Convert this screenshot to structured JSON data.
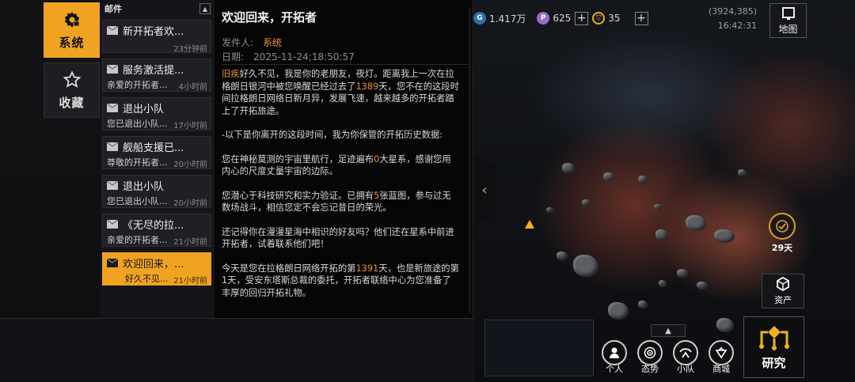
{
  "categories": [
    {
      "label": "系统",
      "icon": "gear-icon",
      "active": true
    },
    {
      "label": "收藏",
      "icon": "star-icon",
      "active": false
    }
  ],
  "mail_list": {
    "header": "邮件",
    "items": [
      {
        "subject": "新开拓者欢...",
        "preview": "",
        "time": "23分钟前"
      },
      {
        "subject": "服务激活提...",
        "preview": "亲爱的开拓者...",
        "time": "4小时前"
      },
      {
        "subject": "退出小队",
        "preview": "您已退出小队...",
        "time": "17小时前"
      },
      {
        "subject": "舰船支援已...",
        "preview": "尊敬的开拓者...",
        "time": "20小时前"
      },
      {
        "subject": "退出小队",
        "preview": "您已退出小队...",
        "time": "20小时前"
      },
      {
        "subject": "《无尽的拉...",
        "preview": "亲爱的开拓者...",
        "time": "21小时前"
      },
      {
        "subject": "欢迎回来，...",
        "preview": "好久不见...",
        "time": "21小时前",
        "active": true
      }
    ]
  },
  "mail_content": {
    "title": "欢迎回来，开拓者",
    "sender_label": "发件人:",
    "sender": "系统",
    "date_label": "日期:",
    "date": "2025-11-24;18:50:57",
    "p1_hl1": "旧疾",
    "p1_a": "好久不见，我是你的老朋友，夜灯。距离我上一次在拉格朗日银河中被您唤醒已经过去了",
    "p1_hl2": "1389",
    "p1_b": "天，您不在的这段时间拉格朗日网络日新月异，发展飞速，越来越多的开拓者踏上了开拓旅途。",
    "p2": "-以下是你离开的这段时间，我为你保管的开拓历史数据:",
    "p3_a": "您在神秘莫测的宇宙里航行，足迹遍布",
    "p3_hl": "0",
    "p3_b": "大星系，感谢您用内心的尺度丈量宇宙的边际。",
    "p4_a": "您潜心于科技研究和实力验证。已拥有",
    "p4_hl": "5",
    "p4_b": "张蓝图，参与过无数场战斗，相信您定不会忘记昔日的荣光。",
    "p5": "还记得你在漫漫星海中相识的好友吗？他们还在星系中前进开拓者，试着联系他们吧！",
    "p6_a": "今天是您在拉格朗日网络开拓的第",
    "p6_hl": "1391",
    "p6_b": "天，也是新旅途的第1天，受安东塔斯总裁的委托，开拓者联络中心为您准备了丰厚的回归开拓礼物。"
  },
  "hud": {
    "resource_1": "1.417万",
    "resource_2": "625",
    "resource_3": "35",
    "coordinates": "(3924,385)",
    "time": "16:42:31",
    "map_label": "地图",
    "days_label": "29天",
    "assets_label": "资产",
    "research_label": "研究",
    "bottom_buttons": [
      "个人",
      "态势",
      "小队",
      "商城"
    ]
  },
  "colors": {
    "accent": "#f0a320",
    "highlight_text": "#e8902a",
    "panel_bg": "#060606"
  }
}
